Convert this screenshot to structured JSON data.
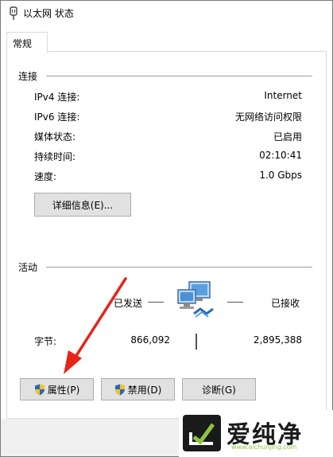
{
  "window": {
    "title": "以太网 状态"
  },
  "tabs": [
    {
      "label": "常规"
    }
  ],
  "connection": {
    "header": "连接",
    "rows": [
      {
        "label": "IPv4 连接:",
        "value": "Internet"
      },
      {
        "label": "IPv6 连接:",
        "value": "无网络访问权限"
      },
      {
        "label": "媒体状态:",
        "value": "已启用"
      },
      {
        "label": "持续时间:",
        "value": "02:10:41"
      },
      {
        "label": "速度:",
        "value": "1.0 Gbps"
      }
    ],
    "details_button": "详细信息(E)..."
  },
  "activity": {
    "header": "活动",
    "sent_label": "已发送",
    "received_label": "已接收",
    "bytes_label": "字节:",
    "bytes_sent": "866,092",
    "bytes_received": "2,895,388"
  },
  "buttons": {
    "properties": "属性(P)",
    "disable": "禁用(D)",
    "diagnose": "诊断(G)"
  },
  "watermark": {
    "brand": "爱纯净",
    "url": "www.aichunjing.com"
  },
  "colors": {
    "accent_arrow": "#e8241a",
    "shield_blue": "#2b63c7",
    "shield_yellow": "#f5c518",
    "watermark_green": "#8cc63f"
  }
}
